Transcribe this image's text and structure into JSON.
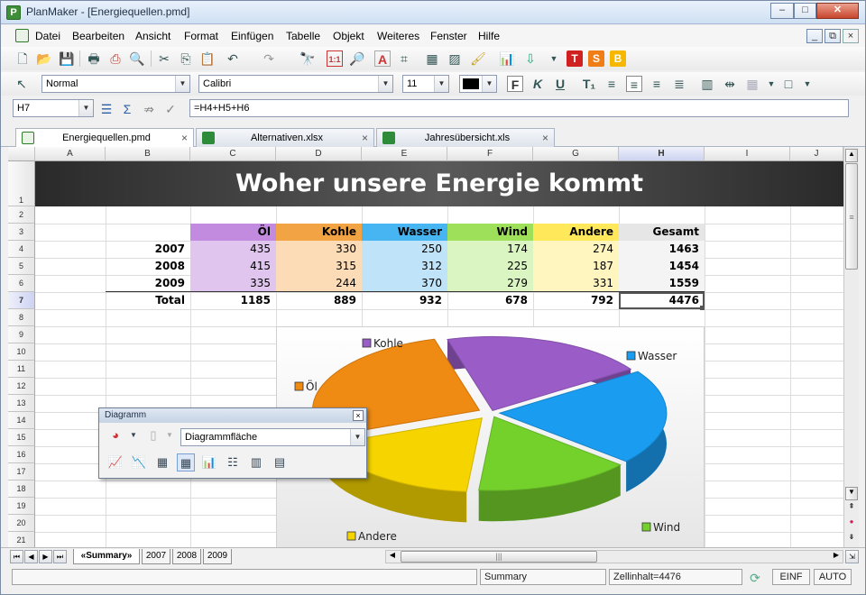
{
  "window": {
    "title": "PlanMaker - [Energiequellen.pmd]",
    "min": "–",
    "max": "□",
    "close": "✕"
  },
  "menu": [
    "Datei",
    "Bearbeiten",
    "Ansicht",
    "Format",
    "Einfügen",
    "Tabelle",
    "Objekt",
    "Weiteres",
    "Fenster",
    "Hilfe"
  ],
  "menu_right": {
    "min": "_",
    "restore": "⧉",
    "close": "×"
  },
  "format_bar": {
    "style": "Normal",
    "font": "Calibri",
    "size": "11"
  },
  "formula_bar": {
    "cell_ref": "H7",
    "formula": "=H4+H5+H6"
  },
  "tabs": [
    {
      "label": "Energiequellen.pmd"
    },
    {
      "label": "Alternativen.xlsx"
    },
    {
      "label": "Jahresübersicht.xls"
    }
  ],
  "tab_close": "×",
  "columns": [
    "A",
    "B",
    "C",
    "D",
    "E",
    "F",
    "G",
    "H",
    "I",
    "J"
  ],
  "rows": [
    "1",
    "2",
    "3",
    "4",
    "5",
    "6",
    "7",
    "8",
    "9",
    "10",
    "11",
    "12",
    "13",
    "14",
    "15",
    "16",
    "17",
    "18",
    "19",
    "20",
    "21"
  ],
  "sheet": {
    "title": "Woher unsere Energie kommt",
    "headers": [
      "Öl",
      "Kohle",
      "Wasser",
      "Wind",
      "Andere",
      "Gesamt"
    ],
    "data_rows": [
      {
        "label": "2007",
        "values": [
          "435",
          "330",
          "250",
          "174",
          "274",
          "1463"
        ]
      },
      {
        "label": "2008",
        "values": [
          "415",
          "315",
          "312",
          "225",
          "187",
          "1454"
        ]
      },
      {
        "label": "2009",
        "values": [
          "335",
          "244",
          "370",
          "279",
          "331",
          "1559"
        ]
      }
    ],
    "total": {
      "label": "Total",
      "values": [
        "1185",
        "889",
        "932",
        "678",
        "792",
        "4476"
      ]
    }
  },
  "chart_data": {
    "type": "pie",
    "categories": [
      "Öl",
      "Kohle",
      "Wasser",
      "Wind",
      "Andere"
    ],
    "values": [
      1185,
      889,
      932,
      678,
      792
    ],
    "colors": [
      "#ef8a12",
      "#9a5cc7",
      "#1a9cf0",
      "#74d12c",
      "#f6d400"
    ],
    "legend_placement": "labels beside slices"
  },
  "dialog": {
    "title": "Diagramm",
    "close": "×",
    "element": "Diagrammfläche"
  },
  "sheet_tabs": [
    "«Summary»",
    "2007",
    "2008",
    "2009"
  ],
  "status": {
    "sheet": "Summary",
    "cell_content": "Zellinhalt=4476",
    "mode1": "EINF",
    "mode2": "AUTO"
  }
}
